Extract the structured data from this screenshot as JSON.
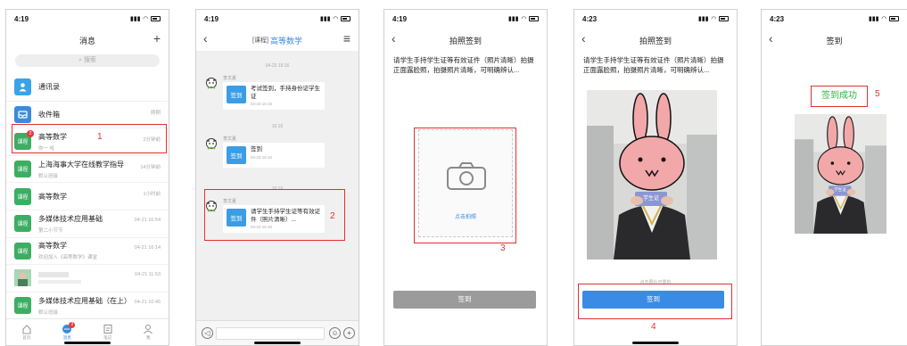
{
  "statusbar": {
    "time_1": "4:19",
    "time_2": "4:19",
    "time_3": "4:19",
    "time_4": "4:23",
    "time_5": "4:23"
  },
  "screen1": {
    "title": "消息",
    "add_label": "+",
    "search_placeholder": "搜索",
    "items": [
      {
        "title": "通讯录",
        "subtitle": "",
        "time": "",
        "icon": "contacts-icon",
        "color": "#3aa3e8",
        "icon_text": ""
      },
      {
        "title": "收件箱",
        "subtitle": "",
        "time": "刚刚",
        "icon": "inbox-icon",
        "color": "#3a8be0",
        "icon_text": ""
      },
      {
        "title": "高等数学",
        "subtitle": "你一 哈",
        "time": "2分钟前",
        "icon": "course-icon",
        "color": "#3cae63",
        "icon_text": "课程",
        "badge": "2"
      },
      {
        "title": "上海海事大学在线教学指导",
        "subtitle": "默认班级",
        "time": "14分钟前",
        "icon": "course-icon",
        "color": "#3cae63",
        "icon_text": "课程"
      },
      {
        "title": "高等数学",
        "subtitle": "",
        "time": "1小时前",
        "icon": "course-icon",
        "color": "#3cae63",
        "icon_text": "课程"
      },
      {
        "title": "多媒体技术应用基础",
        "subtitle": "第二小节节",
        "time": "04-21 16:54",
        "icon": "course-icon",
        "color": "#3cae63",
        "icon_text": "课程"
      },
      {
        "title": "高等数学",
        "subtitle": "欢迎加入《高等数学》课堂",
        "time": "04-21 16:14",
        "icon": "course-icon",
        "color": "#3cae63",
        "icon_text": "课程"
      },
      {
        "title": "",
        "subtitle": "",
        "time": "04-21 11:53",
        "icon": "avatar-icon",
        "color": "#8fc7a0",
        "icon_text": ""
      },
      {
        "title": "多媒体技术应用基础（在上）",
        "subtitle": "默认班级",
        "time": "04-21 10:46",
        "icon": "course-icon",
        "color": "#3cae63",
        "icon_text": "课程"
      }
    ],
    "tabs": [
      {
        "label": "首页",
        "icon": "home-icon"
      },
      {
        "label": "消息",
        "icon": "message-icon",
        "badge": "3"
      },
      {
        "label": "笔记",
        "icon": "note-icon"
      },
      {
        "label": "我",
        "icon": "profile-icon"
      }
    ],
    "step_number": "1"
  },
  "screen2": {
    "title_tag": "[课程]",
    "title_name": "高等数学",
    "messages": [
      {
        "time": "04-23 16:16",
        "sender": "李文夏",
        "icon_label": "签到",
        "title": "考试签到，手持身份证学生证",
        "date": "04-23 16:16"
      },
      {
        "time": "16:16",
        "sender": "李文夏",
        "icon_label": "签到",
        "title": "签到",
        "date": "04-23 16:16"
      },
      {
        "time": "16:16",
        "sender": "李文夏",
        "icon_label": "签到",
        "title": "请学生手持学生证等有效证件（照片清晰）...",
        "date": "04-23 16:16"
      }
    ],
    "step_number": "2"
  },
  "screen3": {
    "title": "拍照签到",
    "instruction": "请学生手持学生证等有效证件（照片清晰）拍摄正面露脸照，拍摄照片清晰，可明确辨认...",
    "capture_label": "点击拍照",
    "button": "签到",
    "step_number": "3"
  },
  "screen4": {
    "title": "拍照签到",
    "instruction": "请学生手持学生证等有效证件（照片清晰）拍摄正面露脸照，拍摄照片清晰，可明确辨认...",
    "card_text": "学生证",
    "retake_hint": "点击照片可重拍",
    "button": "签到",
    "step_number": "4"
  },
  "screen5": {
    "title": "签到",
    "success": "签到成功",
    "card_text": "学生证",
    "step_number": "5"
  },
  "colors": {
    "accent": "#3a8be0",
    "highlight": "#e03030",
    "course_green": "#3cae63",
    "success_green": "#2fb344",
    "button_gray": "#9b9b9b"
  }
}
